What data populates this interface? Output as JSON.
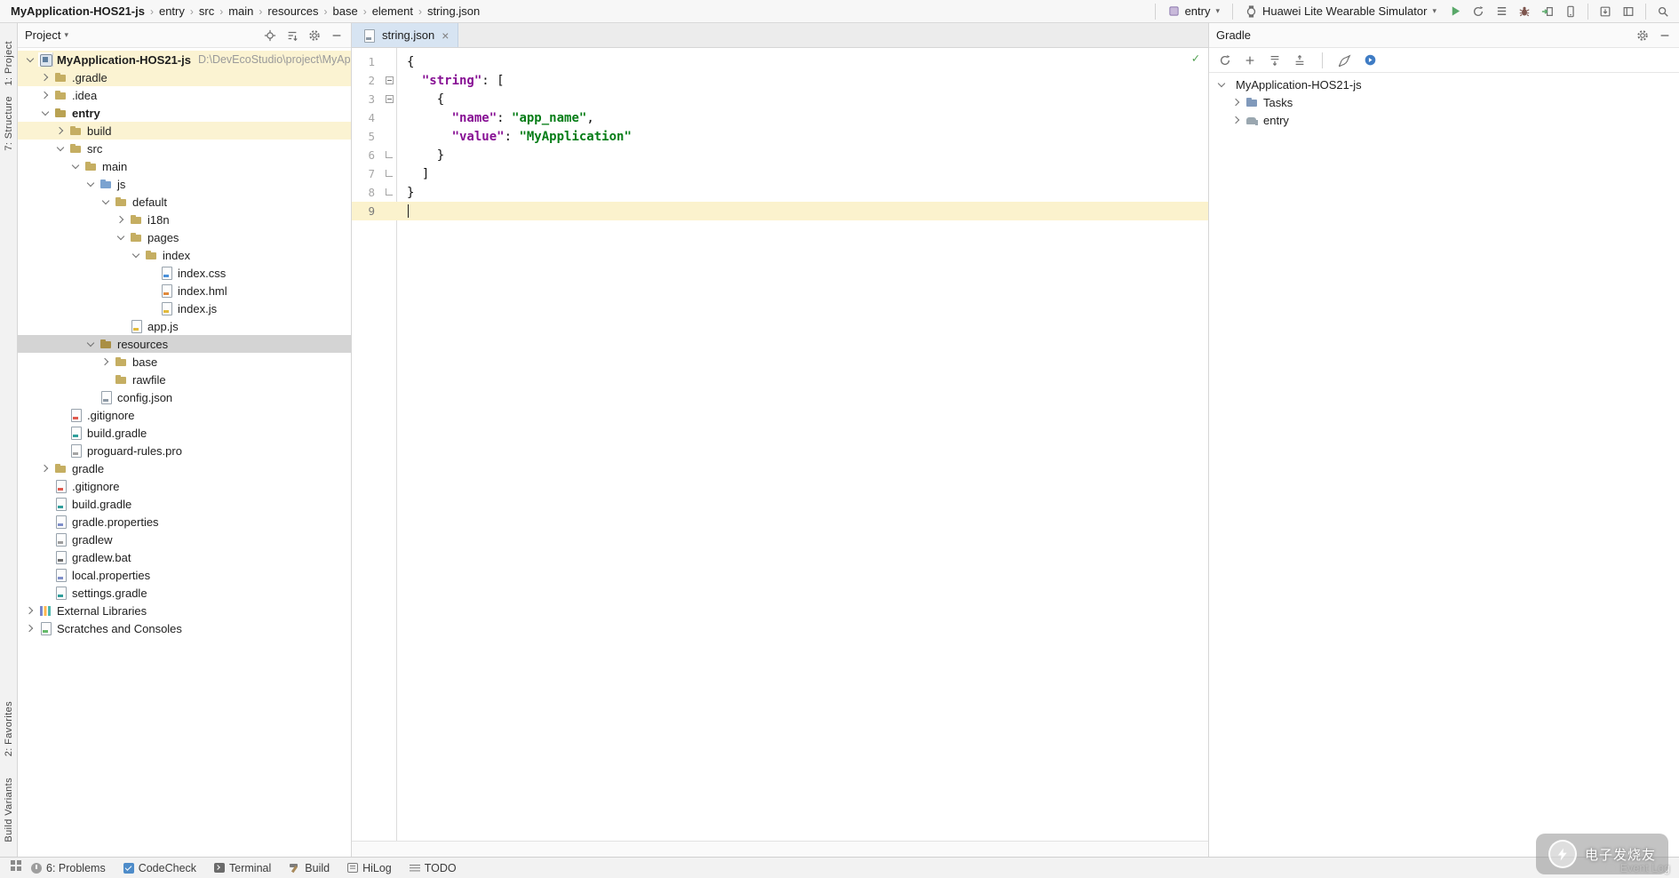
{
  "glyphs": {
    "caret_down": "▾",
    "close": "×",
    "inspection_ok": "✓",
    "breadcrumb_sep": "›"
  },
  "colors": {
    "run_green": "#59a869",
    "selection_gray": "#d4d4d4",
    "excluded_row_yellow": "#fbf3d2",
    "caret_line_yellow": "#fbf2cd",
    "json_key": "#871094",
    "json_string": "#067d17",
    "active_tab_blue": "#d7e4f2"
  },
  "breadcrumbs": [
    "MyApplication-HOS21-js",
    "entry",
    "src",
    "main",
    "resources",
    "base",
    "element",
    "string.json"
  ],
  "toolbar": {
    "module_selector": "entry",
    "device_selector": "Huawei Lite Wearable Simulator"
  },
  "left_stripe": {
    "top": [
      "1: Project",
      "7: Structure"
    ],
    "bottom": [
      "2: Favorites",
      "Build Variants"
    ]
  },
  "project_panel": {
    "title": "Project",
    "tree": [
      {
        "label": "MyApplication-HOS21-js",
        "path": "D:\\DevEcoStudio\\project\\MyAp",
        "depth": 0,
        "kind": "project",
        "chev": "open",
        "bold": true,
        "bg": "yellow"
      },
      {
        "label": ".gradle",
        "depth": 1,
        "kind": "folder",
        "chev": "closed",
        "bg": "yellow"
      },
      {
        "label": ".idea",
        "depth": 1,
        "kind": "folder",
        "chev": "closed"
      },
      {
        "label": "entry",
        "depth": 1,
        "kind": "module",
        "chev": "open",
        "bold": true
      },
      {
        "label": "build",
        "depth": 2,
        "kind": "folder",
        "chev": "closed",
        "bg": "yellow"
      },
      {
        "label": "src",
        "depth": 2,
        "kind": "folder",
        "chev": "open"
      },
      {
        "label": "main",
        "depth": 3,
        "kind": "folder",
        "chev": "open"
      },
      {
        "label": "js",
        "depth": 4,
        "kind": "folder-src",
        "chev": "open"
      },
      {
        "label": "default",
        "depth": 5,
        "kind": "folder",
        "chev": "open"
      },
      {
        "label": "i18n",
        "depth": 6,
        "kind": "folder",
        "chev": "closed"
      },
      {
        "label": "pages",
        "depth": 6,
        "kind": "folder",
        "chev": "open"
      },
      {
        "label": "index",
        "depth": 7,
        "kind": "folder",
        "chev": "open"
      },
      {
        "label": "index.css",
        "depth": 8,
        "kind": "file-css"
      },
      {
        "label": "index.hml",
        "depth": 8,
        "kind": "file-hml"
      },
      {
        "label": "index.js",
        "depth": 8,
        "kind": "file-js"
      },
      {
        "label": "app.js",
        "depth": 6,
        "kind": "file-js"
      },
      {
        "label": "resources",
        "depth": 4,
        "kind": "folder-res",
        "chev": "open",
        "selected": true
      },
      {
        "label": "base",
        "depth": 5,
        "kind": "folder",
        "chev": "closed"
      },
      {
        "label": "rawfile",
        "depth": 5,
        "kind": "folder"
      },
      {
        "label": "config.json",
        "depth": 4,
        "kind": "file-json"
      },
      {
        "label": ".gitignore",
        "depth": 2,
        "kind": "file-git"
      },
      {
        "label": "build.gradle",
        "depth": 2,
        "kind": "file-gradle"
      },
      {
        "label": "proguard-rules.pro",
        "depth": 2,
        "kind": "file-pro"
      },
      {
        "label": "gradle",
        "depth": 1,
        "kind": "folder",
        "chev": "closed"
      },
      {
        "label": ".gitignore",
        "depth": 1,
        "kind": "file-git"
      },
      {
        "label": "build.gradle",
        "depth": 1,
        "kind": "file-gradle"
      },
      {
        "label": "gradle.properties",
        "depth": 1,
        "kind": "file-prop"
      },
      {
        "label": "gradlew",
        "depth": 1,
        "kind": "file-sh"
      },
      {
        "label": "gradlew.bat",
        "depth": 1,
        "kind": "file-bat"
      },
      {
        "label": "local.properties",
        "depth": 1,
        "kind": "file-prop"
      },
      {
        "label": "settings.gradle",
        "depth": 1,
        "kind": "file-gradle"
      },
      {
        "label": "External Libraries",
        "depth": 0,
        "kind": "libs",
        "chev": "closed"
      },
      {
        "label": "Scratches and Consoles",
        "depth": 0,
        "kind": "scratches",
        "chev": "closed"
      }
    ]
  },
  "editor": {
    "tab_label": "string.json",
    "caret_line": 9,
    "lines": [
      {
        "n": 1,
        "fold": "",
        "segs": [
          [
            "p",
            "{"
          ]
        ]
      },
      {
        "n": 2,
        "fold": "box",
        "segs": [
          [
            "p",
            "  "
          ],
          [
            "k",
            "\"string\""
          ],
          [
            "p",
            ": ["
          ]
        ]
      },
      {
        "n": 3,
        "fold": "box",
        "segs": [
          [
            "p",
            "    {"
          ]
        ]
      },
      {
        "n": 4,
        "fold": "",
        "segs": [
          [
            "p",
            "      "
          ],
          [
            "k",
            "\"name\""
          ],
          [
            "p",
            ": "
          ],
          [
            "s",
            "\"app_name\""
          ],
          [
            "p",
            ","
          ]
        ]
      },
      {
        "n": 5,
        "fold": "",
        "segs": [
          [
            "p",
            "      "
          ],
          [
            "k",
            "\"value\""
          ],
          [
            "p",
            ": "
          ],
          [
            "s",
            "\"MyApplication\""
          ]
        ]
      },
      {
        "n": 6,
        "fold": "end",
        "segs": [
          [
            "p",
            "    }"
          ]
        ]
      },
      {
        "n": 7,
        "fold": "end",
        "segs": [
          [
            "p",
            "  ]"
          ]
        ]
      },
      {
        "n": 8,
        "fold": "end",
        "segs": [
          [
            "p",
            "}"
          ]
        ]
      },
      {
        "n": 9,
        "fold": "",
        "segs": []
      }
    ]
  },
  "gradle_panel": {
    "title": "Gradle",
    "tree": [
      {
        "label": "MyApplication-HOS21-js",
        "depth": 0,
        "kind": "gproject",
        "chev": "open"
      },
      {
        "label": "Tasks",
        "depth": 1,
        "kind": "gtasks",
        "chev": "closed"
      },
      {
        "label": "entry",
        "depth": 1,
        "kind": "gmodule",
        "chev": "closed"
      }
    ]
  },
  "status_bar": {
    "items": [
      {
        "label": "6: Problems",
        "icon": "problems"
      },
      {
        "label": "CodeCheck",
        "icon": "codecheck"
      },
      {
        "label": "Terminal",
        "icon": "terminal"
      },
      {
        "label": "Build",
        "icon": "build"
      },
      {
        "label": "HiLog",
        "icon": "hilog"
      },
      {
        "label": "TODO",
        "icon": "todo"
      }
    ],
    "event_log": "Event Log"
  },
  "watermark": {
    "text": "电子发烧友"
  }
}
